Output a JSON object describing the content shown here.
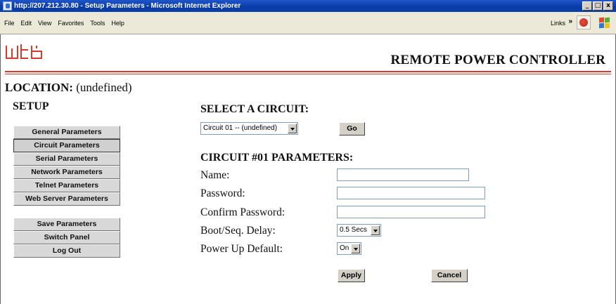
{
  "window": {
    "title": "http://207.212.30.80 - Setup Parameters - Microsoft Internet Explorer",
    "minimize_glyph": "_",
    "maximize_glyph": "□",
    "close_glyph": "x"
  },
  "menubar": {
    "menus": [
      "File",
      "Edit",
      "View",
      "Favorites",
      "Tools",
      "Help"
    ],
    "links_label": "Links",
    "chevron": "»"
  },
  "brand": {
    "logo_text": "wti",
    "product": "REMOTE POWER CONTROLLER",
    "accent_color": "#d63a2a"
  },
  "location": {
    "label": "LOCATION:",
    "value": "(undefined)"
  },
  "setup": {
    "title": "SETUP",
    "menu": [
      "General Parameters",
      "Circuit Parameters",
      "Serial Parameters",
      "Network Parameters",
      "Telnet Parameters",
      "Web Server Parameters"
    ],
    "actions": [
      "Save Parameters",
      "Switch Panel",
      "Log Out"
    ],
    "active_item": "Circuit Parameters"
  },
  "select_circuit": {
    "heading": "SELECT A CIRCUIT:",
    "selected": "Circuit 01 -- (undefined)",
    "go_label": "Go"
  },
  "circuit_params": {
    "heading": "CIRCUIT #01 PARAMETERS:",
    "fields": {
      "name": {
        "label": "Name:",
        "value": ""
      },
      "password": {
        "label": "Password:",
        "value": ""
      },
      "confirm_password": {
        "label": "Confirm Password:",
        "value": ""
      },
      "boot_delay": {
        "label": "Boot/Seq. Delay:",
        "selected": "0.5 Secs"
      },
      "power_up_default": {
        "label": "Power Up Default:",
        "selected": "On"
      }
    },
    "apply_label": "Apply",
    "cancel_label": "Cancel"
  }
}
